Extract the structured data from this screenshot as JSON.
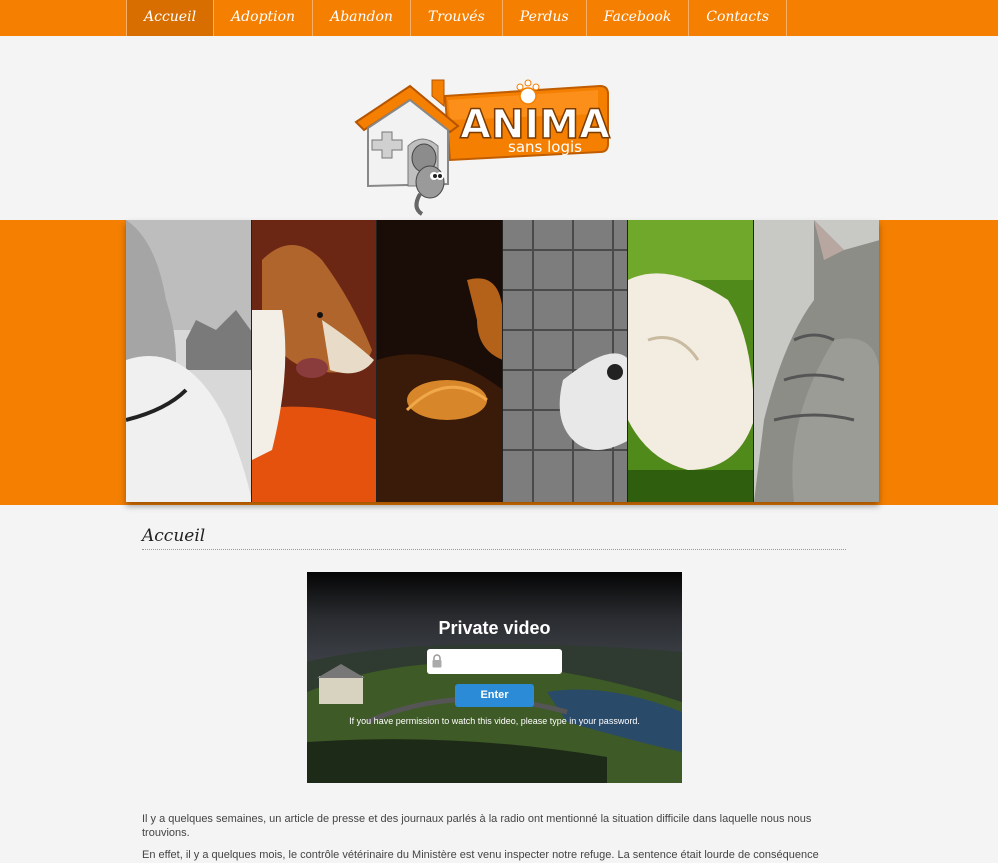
{
  "nav": {
    "items": [
      {
        "label": "Accueil",
        "active": true
      },
      {
        "label": "Adoption",
        "active": false
      },
      {
        "label": "Abandon",
        "active": false
      },
      {
        "label": "Trouvés",
        "active": false
      },
      {
        "label": "Perdus",
        "active": false
      },
      {
        "label": "Facebook",
        "active": false
      },
      {
        "label": "Contacts",
        "active": false
      }
    ]
  },
  "logo": {
    "title": "ANIMAL",
    "subtitle": "sans logis"
  },
  "banner": {
    "photos": [
      "dog-photo-bw",
      "collie-photo",
      "orange-cat-photo",
      "dog-photo-bw-cobblestone",
      "white-dog-grass-photo",
      "tabby-cat-photo"
    ]
  },
  "page": {
    "title": "Accueil"
  },
  "video": {
    "title": "Private video",
    "password_placeholder": "",
    "enter_label": "Enter",
    "note": "If you have permission to watch this video, please type in your password."
  },
  "content": {
    "p1": "Il y a quelques semaines, un article de presse et des journaux parlés à la radio ont mentionné la situation difficile dans laquelle nous nous trouvions.",
    "p2": "En effet, il y a quelques mois, le contrôle vétérinaire du Ministère est venu inspecter notre refuge. La sentence était lourde de conséquence : ou"
  },
  "colors": {
    "accent": "#f47f00",
    "accent_dark": "#d86e00",
    "button": "#2b8bd6"
  }
}
